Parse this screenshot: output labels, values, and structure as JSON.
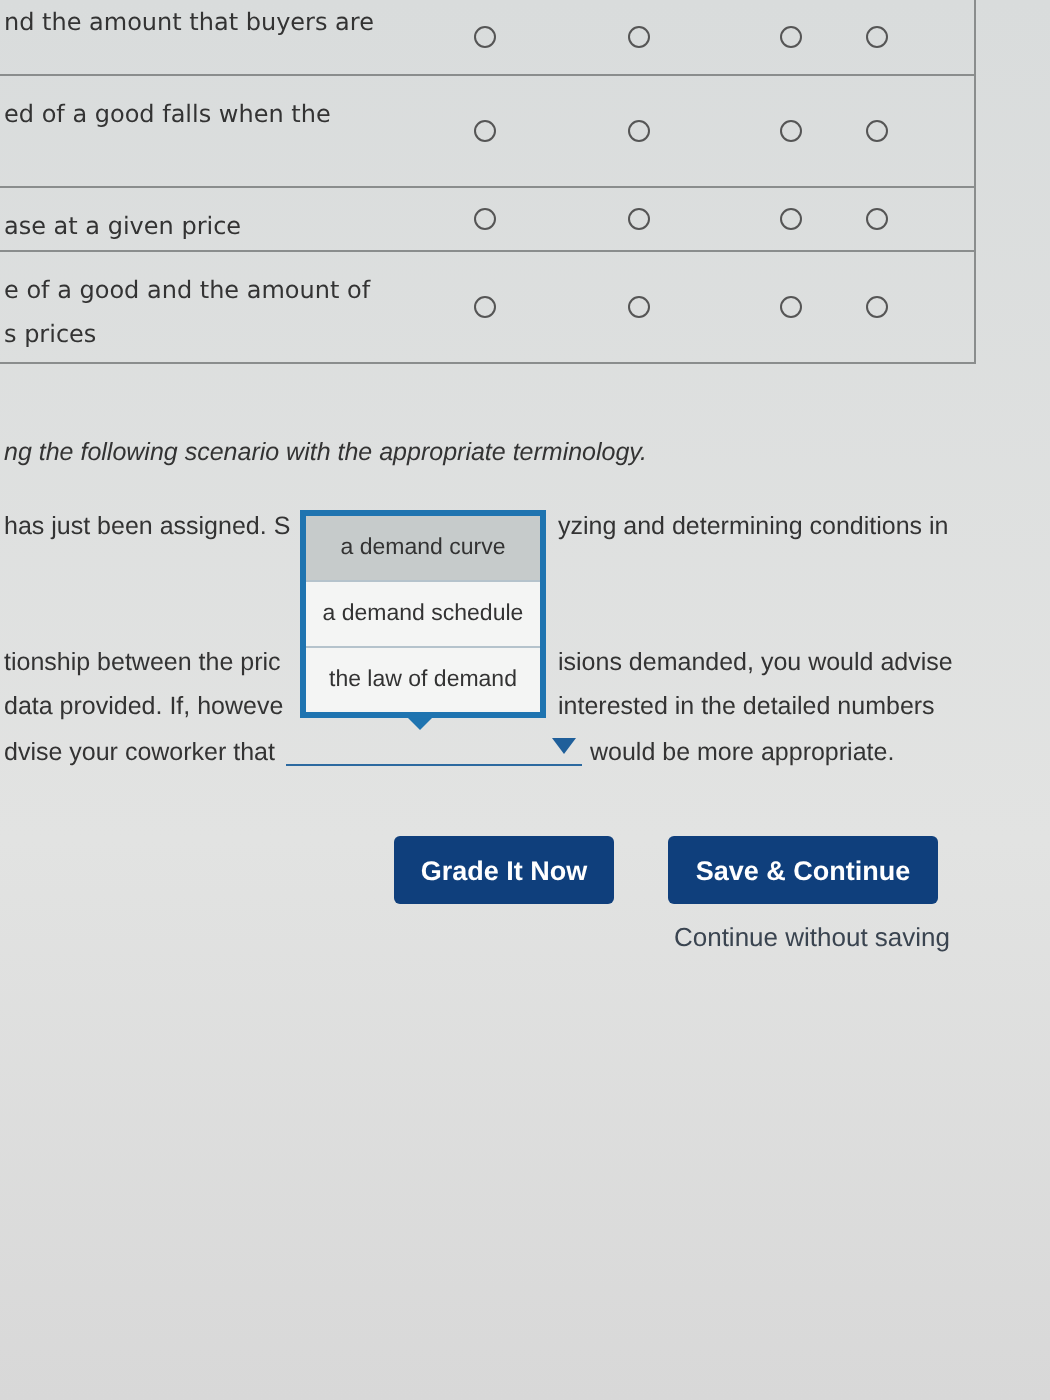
{
  "table": {
    "rows": [
      {
        "statement": "nd the amount that buyers are",
        "options": [
          {
            "selected": false
          },
          {
            "selected": false
          },
          {
            "selected": false
          },
          {
            "selected": false
          }
        ]
      },
      {
        "statement": "ed of a good falls when the",
        "options": [
          {
            "selected": false
          },
          {
            "selected": false
          },
          {
            "selected": false
          },
          {
            "selected": false
          }
        ]
      },
      {
        "statement": "ase at a given price",
        "options": [
          {
            "selected": false
          },
          {
            "selected": false
          },
          {
            "selected": false
          },
          {
            "selected": false
          }
        ]
      },
      {
        "statement": "e of a good and the amount of\ns prices",
        "options": [
          {
            "selected": false
          },
          {
            "selected": false
          },
          {
            "selected": false
          },
          {
            "selected": false
          }
        ]
      }
    ]
  },
  "instruction": "ng the following scenario with the appropriate terminology.",
  "scenario_lines": [
    {
      "left": "has just been assigned. S",
      "right": "yzing and determining conditions in"
    },
    {
      "left": "tionship between the pric",
      "right": "isions demanded, you would advise"
    },
    {
      "left": "data provided. If, howeve",
      "right": "interested in the detailed numbers"
    }
  ],
  "last_line": {
    "before": "dvise your coworker that",
    "after": "would be more appropriate."
  },
  "dropdown": {
    "expanded": true,
    "options": [
      {
        "label": "a demand curve",
        "selected": true
      },
      {
        "label": "a demand schedule",
        "selected": false
      },
      {
        "label": "the law of demand",
        "selected": false
      }
    ]
  },
  "buttons": [
    {
      "label": "Grade It Now"
    },
    {
      "label": "Save & Continue"
    }
  ],
  "link": "Continue without saving"
}
